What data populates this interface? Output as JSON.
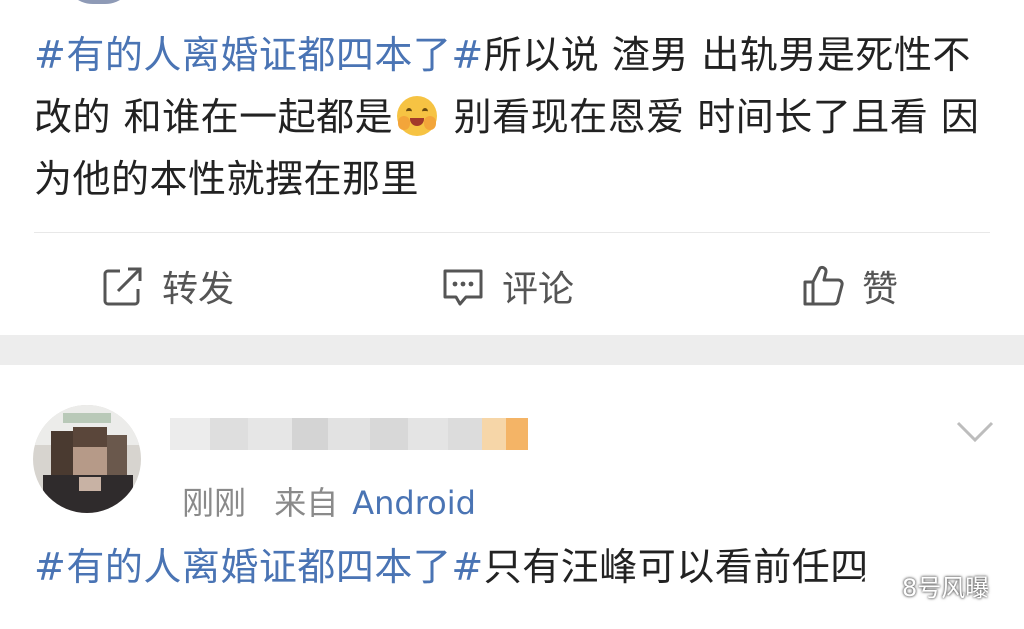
{
  "post": {
    "hashtag": "#有的人离婚证都四本了#",
    "text_part1": "所以说 渣男 出轨男是死性不改的 和谁在一起都是",
    "emoji": "smile-blush-emoji",
    "text_part2": " 别看现在恩爱 时间长了且看 因为他的本性就摆在那里"
  },
  "actions": {
    "repost": "转发",
    "comment": "评论",
    "like": "赞"
  },
  "comment": {
    "time": "刚刚",
    "source_prefix": "来自",
    "source": "Android",
    "hashtag": "#有的人离婚证都四本了#",
    "text": "只有汪峰可以看前任四"
  },
  "watermark": {
    "text": "8号风曝"
  },
  "colors": {
    "link": "#4a74b4",
    "text": "#222222",
    "separator": "#ededed"
  }
}
